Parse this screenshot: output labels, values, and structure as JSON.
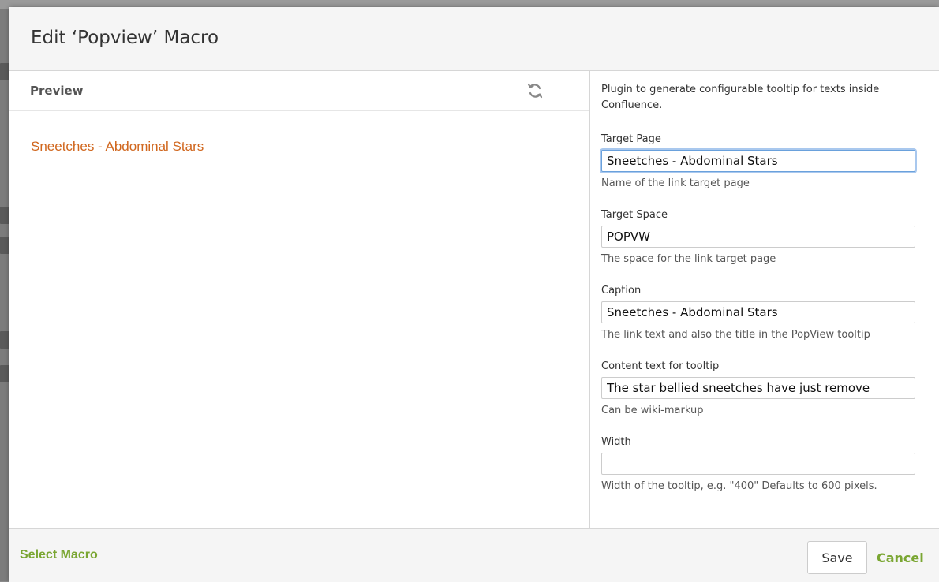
{
  "dialog": {
    "title": "Edit ‘Popview’ Macro"
  },
  "preview": {
    "label": "Preview",
    "refresh_icon": "refresh-icon",
    "link_text": "Sneetches - Abdominal Stars",
    "link_color": "#d0661d"
  },
  "params": {
    "intro": "Plugin to generate configurable tooltip for texts inside Confluence.",
    "target_page": {
      "label": "Target Page",
      "value": "Sneetches - Abdominal Stars",
      "help": "Name of the link target page"
    },
    "target_space": {
      "label": "Target Space",
      "value": "POPVW",
      "help": "The space for the link target page"
    },
    "caption": {
      "label": "Caption",
      "value": "Sneetches - Abdominal Stars",
      "help": "The link text and also the title in the PopView tooltip"
    },
    "content": {
      "label": "Content text for tooltip",
      "value": "The star bellied sneetches have just remove",
      "help": "Can be wiki-markup"
    },
    "width": {
      "label": "Width",
      "value": "",
      "help": "Width of the tooltip, e.g. \"400\" Defaults to 600 pixels."
    }
  },
  "footer": {
    "select_macro": "Select Macro",
    "save": "Save",
    "cancel": "Cancel",
    "accent_color": "#7aa632"
  }
}
